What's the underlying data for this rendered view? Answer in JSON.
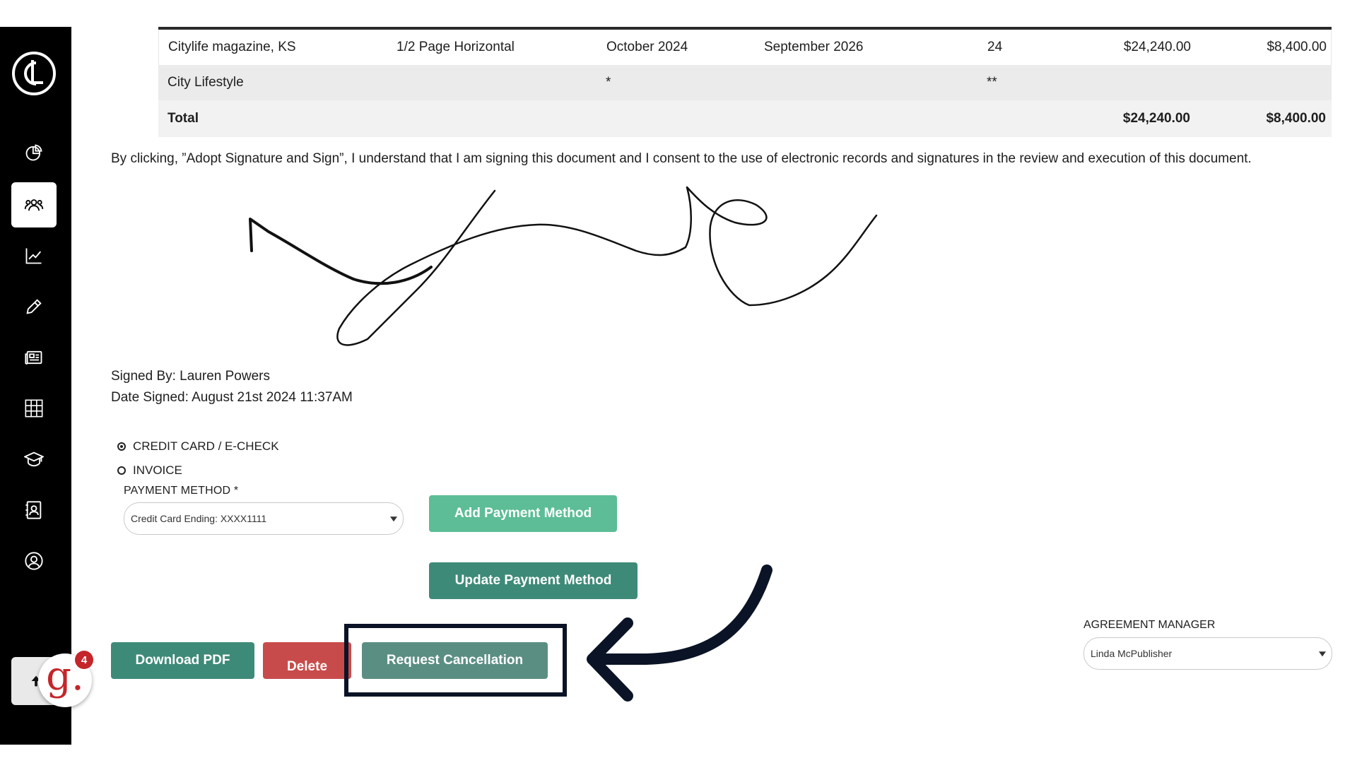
{
  "sidebar": {
    "logo_letters": "CL",
    "items": [
      {
        "icon": "pie-chart-icon",
        "active": false
      },
      {
        "icon": "users-icon",
        "active": true
      },
      {
        "icon": "line-chart-icon",
        "active": false
      },
      {
        "icon": "pencil-icon",
        "active": false
      },
      {
        "icon": "newspaper-icon",
        "active": false
      },
      {
        "icon": "grid-icon",
        "active": false
      },
      {
        "icon": "graduation-cap-icon",
        "active": false
      },
      {
        "icon": "contacts-icon",
        "active": false
      },
      {
        "icon": "user-circle-icon",
        "active": false
      }
    ],
    "scroll_top_icon": "arrow-up-icon"
  },
  "badge": {
    "letter": "g.",
    "count": "4",
    "color": "#c4262a"
  },
  "table": {
    "rows": [
      {
        "publication": "Citylife magazine, KS",
        "ad_size": "1/2 Page Horizontal",
        "start": "October 2024",
        "end": "September 2026",
        "issues": "24",
        "total": "$24,240.00",
        "amount": "$8,400.00"
      },
      {
        "publication": "City Lifestyle",
        "ad_size": "",
        "start": "*",
        "end": "",
        "issues": "**",
        "total": "",
        "amount": ""
      }
    ],
    "total_row": {
      "label": "Total",
      "total": "$24,240.00",
      "amount": "$8,400.00"
    }
  },
  "consent_text": "By clicking, ”Adopt Signature and Sign”, I understand that I am signing this document and I consent to the use of electronic records and signatures in the review and execution of this document.",
  "signed_by": "Signed By: Lauren Powers",
  "date_signed": "Date Signed: August 21st 2024 11:37AM",
  "payment": {
    "options": [
      {
        "label": "CREDIT CARD / E-CHECK",
        "selected": true
      },
      {
        "label": "INVOICE",
        "selected": false
      }
    ],
    "method_label": "PAYMENT METHOD *",
    "method_value": "Credit Card Ending: XXXX1111",
    "add_button": "Add Payment Method",
    "update_button": "Update Payment Method"
  },
  "actions": {
    "download": "Download PDF",
    "delete": "Delete",
    "request_cancellation": "Request Cancellation"
  },
  "agreement_manager": {
    "label": "AGREEMENT MANAGER",
    "value": "Linda McPublisher"
  },
  "colors": {
    "primary_green": "#3e8a78",
    "light_green": "#5cbd96",
    "delete_red": "#c84b4b",
    "highlight_navy": "#0b1426"
  }
}
